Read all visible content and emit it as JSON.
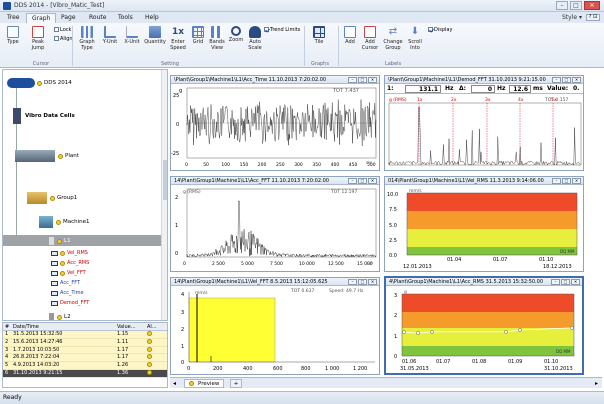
{
  "window": {
    "title": "DDS 2014 - [Vibro_Matic_Test]"
  },
  "menu": {
    "tabs": [
      "Tree",
      "Graph",
      "Page",
      "Route",
      "Tools",
      "Help"
    ],
    "active": "Graph",
    "style_label": "Style"
  },
  "ribbon": {
    "cursor": {
      "type": "Type",
      "peak_jump": "Peak Jump",
      "lock": "Lock",
      "align": "Align",
      "group": "Cursor"
    },
    "setting": {
      "graph_type": "Graph Type",
      "yunit": "Y-Unit",
      "xunit": "X-Unit",
      "quantity": "Quantity",
      "enter_speed": "Enter Speed",
      "grid": "Grid",
      "bands_view": "Bands View",
      "zoom": "Zoom",
      "auto_scale": "Auto Scale",
      "trend_limits": "Trend Limits",
      "group": "Setting"
    },
    "graphs": {
      "tile": "Tile",
      "group": "Graphs"
    },
    "labels": {
      "add": "Add",
      "add_cursor": "Add Cursor",
      "change_group": "Change Group",
      "scroll_into": "Scroll Into",
      "display": "Display",
      "group": "Labels"
    }
  },
  "tree": {
    "root": "DDS 2014",
    "data_cells": "Vibro Data Cells",
    "plant": "Plant",
    "group": "Group1",
    "machine": "Machine1",
    "l1": "L1",
    "signals": [
      "Vel_RMS",
      "Acc_RMS",
      "Vel_FFT",
      "Acc_FFT",
      "Acc_Time",
      "Demod_FFT"
    ],
    "l2": "L2"
  },
  "history": {
    "headers": [
      "#",
      "Date/Time",
      "Value...",
      "Al..."
    ],
    "rows": [
      {
        "n": "1",
        "date": "31.5.2013 15:32:50",
        "value": "1.15"
      },
      {
        "n": "2",
        "date": "15.6.2013 14:27:46",
        "value": "1.11"
      },
      {
        "n": "3",
        "date": "1.7.2013 10:03:50",
        "value": "1.17"
      },
      {
        "n": "4",
        "date": "26.8.2013 7:22:04",
        "value": "1.17"
      },
      {
        "n": "5",
        "date": "4.9.2013 14:03:20",
        "value": "1.26"
      },
      {
        "n": "6",
        "date": "31.10.2013 9:21:15",
        "value": "1.36"
      }
    ]
  },
  "panes": {
    "acc_time": {
      "title": "\\Plant\\Group1\\Machine1\\L1\\Acc_Time   11.10.2013 7:20:02.00",
      "tot": "TOT 7.437",
      "ylabel_unit": "g",
      "x_ticks": [
        "0",
        "50",
        "100",
        "150",
        "200",
        "250",
        "300",
        "350",
        "400",
        "450",
        "500"
      ],
      "y_ticks": [
        "25",
        "0",
        "-25"
      ],
      "xunit": "ms"
    },
    "demod": {
      "title": "\\Plant\\Group1\\Machine1\\L1\\Demod_FFT   31.10.2013 9:21:15.00",
      "cursor_label": "1:",
      "cursor_val": "131.1",
      "cursor_unit": "Hz",
      "delta_label": "Δ:",
      "delta_val": "0",
      "delta_unit": "Hz",
      "third_val": "12.6",
      "third_unit": "ms",
      "value_label": "Value:",
      "value_val": "0.",
      "rms": "g (RMS)",
      "tot": "TOT 0.157",
      "harmonics": [
        "1x",
        "2x",
        "3x",
        "4x",
        "5x"
      ]
    },
    "acc_fft": {
      "title": "14\\Plant\\Group1\\Machine1\\L1\\Acc_FFT   11.10.2013 7:20:02.00",
      "rms": "g (RMS)",
      "tot": "TOT 12.197",
      "x_ticks": [
        "0",
        "2 500",
        "5 000",
        "7 500",
        "10 000",
        "12 500",
        "15 000"
      ],
      "y_ticks": [
        "2",
        "1",
        "0"
      ],
      "xunit": "Hz"
    },
    "vel_rms": {
      "title": "014\\Plant\\Group1\\Machine1\\L1\\Vel_RMS   11.3.2013 9:14:06.00",
      "yunit": "mm/s",
      "y_ticks": [
        "10.0",
        "7.5",
        "5.0",
        "2.5",
        "0.0"
      ],
      "x_ticks": [
        "01.04",
        "01.07",
        "01.10"
      ],
      "start": "12.01.2013",
      "end": "18.12.2013",
      "mode": "DQ MM"
    },
    "vel_fft": {
      "title": "14\\Plant\\Group1\\Machine1\\L1\\Vel_FFT   8.5.2013 15:12:05.625",
      "tot": "TOT 0.637",
      "speed": "Speed: 49.7 Hz",
      "yunit": "mm/s",
      "y_ticks": [
        "4",
        "3",
        "2",
        "1",
        "0"
      ],
      "x_ticks": [
        "0",
        "200",
        "400",
        "600",
        "800",
        "1 000",
        "1 200"
      ]
    },
    "acc_rms": {
      "title": "4\\Plant\\Group1\\Machine1\\L1\\Acc_RMS   31.5.2013 15:32:50.00",
      "yunit": "g",
      "y_ticks": [
        "3",
        "2",
        "1",
        "0"
      ],
      "x_ticks": [
        "01.06",
        "01.07",
        "01.08",
        "01.09",
        "01.10"
      ],
      "start": "31.05.2013",
      "end": "31.10.2013",
      "mode": "DQ MM"
    }
  },
  "tabs": {
    "preview": "Preview",
    "plus": "+"
  },
  "status": {
    "text": "Ready"
  },
  "chart_data": [
    {
      "type": "line",
      "title": "Acc_Time",
      "ylim": [
        -25,
        25
      ],
      "xlim": [
        0,
        500
      ],
      "xlabel": "ms",
      "ylabel": "g"
    },
    {
      "type": "line",
      "title": "Demod_FFT",
      "ylabel": "g (RMS)"
    },
    {
      "type": "line",
      "title": "Acc_FFT",
      "ylim": [
        0,
        2
      ],
      "xlim": [
        0,
        15000
      ],
      "xlabel": "Hz",
      "ylabel": "g (RMS)"
    },
    {
      "type": "line",
      "title": "Vel_RMS",
      "ylim": [
        0,
        10
      ],
      "ylabel": "mm/s"
    },
    {
      "type": "bar",
      "title": "Vel_FFT",
      "ylim": [
        0,
        4
      ],
      "xlim": [
        0,
        1200
      ],
      "ylabel": "mm/s"
    },
    {
      "type": "line",
      "title": "Acc_RMS",
      "ylim": [
        0,
        3
      ],
      "ylabel": "g",
      "x": [
        "31.5.2013",
        "15.6.2013",
        "1.7.2013",
        "26.8.2013",
        "4.9.2013",
        "31.10.2013"
      ],
      "values": [
        1.15,
        1.11,
        1.17,
        1.17,
        1.26,
        1.36
      ]
    }
  ]
}
